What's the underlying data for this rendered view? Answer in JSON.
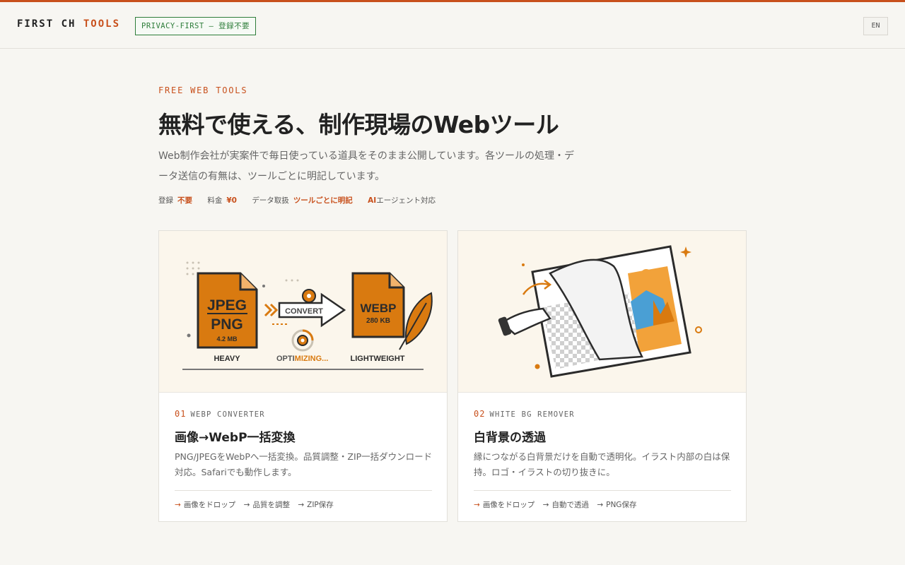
{
  "header": {
    "logo_main": "FIRST CH",
    "logo_accent": "TOOLS",
    "badge": "PRIVACY-FIRST — 登録不要",
    "lang": "EN"
  },
  "hero": {
    "eyebrow": "FREE WEB TOOLS",
    "title": "無料で使える、制作現場のWebツール",
    "description": "Web制作会社が実案件で毎日使っている道具をそのまま公開しています。各ツールの処理・データ送信の有無は、ツールごとに明記しています。",
    "meta": {
      "reg_label": "登録",
      "reg_value": "不要",
      "fee_label": "料金",
      "fee_value": "¥0",
      "data_label": "データ取扱",
      "data_value": "ツールごとに明記",
      "ai_accent": "AI",
      "ai_rest": "エージェント対応"
    }
  },
  "cards": [
    {
      "number": "01",
      "tag": "WEBP CONVERTER",
      "title": "画像→WebP一括変換",
      "description": "PNG/JPEGをWebPへ一括変換。品質調整・ZIP一括ダウンロード対応。Safariでも動作します。",
      "steps": [
        "画像をドロップ",
        "品質を調整",
        "ZIP保存"
      ],
      "visual": {
        "source_format_1": "JPEG",
        "source_format_2": "PNG",
        "source_size": "4.2 MB",
        "target_format": "WEBP",
        "target_size": "280 KB",
        "convert_label": "CONVERT",
        "heavy_label": "HEAVY",
        "optimizing_a": "OPTI",
        "optimizing_b": "MIZING...",
        "light_label": "LIGHTWEIGHT"
      }
    },
    {
      "number": "02",
      "tag": "WHITE BG REMOVER",
      "title": "白背景の透過",
      "description": "縁につながる白背景だけを自動で透明化。イラスト内部の白は保持。ロゴ・イラストの切り抜きに。",
      "steps": [
        "画像をドロップ",
        "自動で透過",
        "PNG保存"
      ]
    }
  ],
  "colors": {
    "accent": "#c8501c",
    "green": "#2e7d3a",
    "orange": "#d97a10"
  }
}
